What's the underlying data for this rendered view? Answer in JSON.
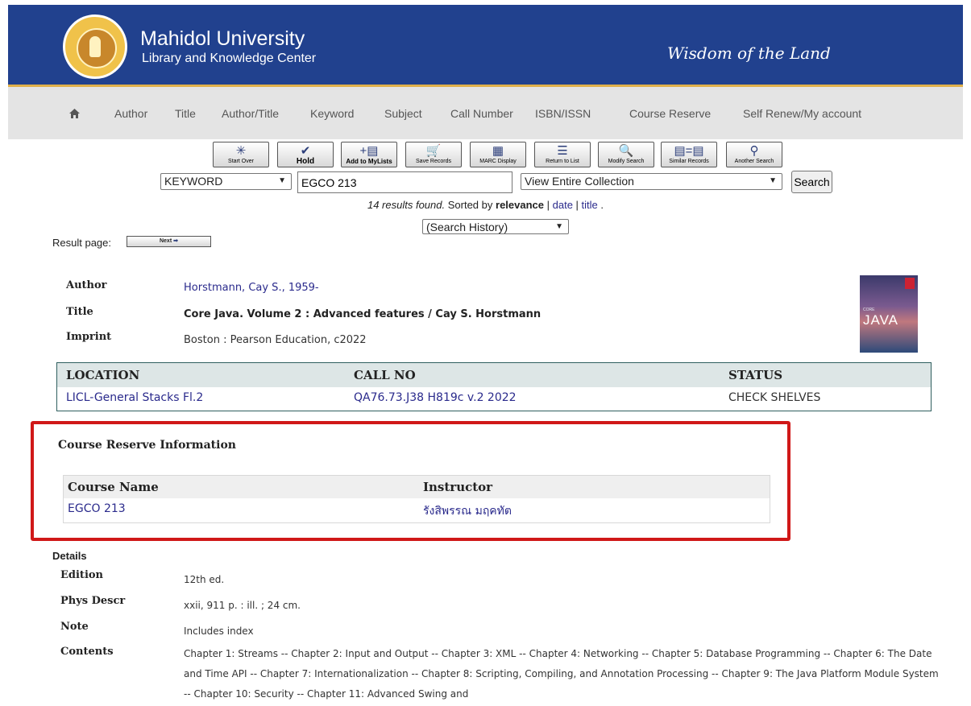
{
  "header": {
    "university": "Mahidol University",
    "subtitle": "Library and Knowledge Center",
    "motto": "Wisdom of the Land",
    "colors": {
      "banner": "#21418e",
      "accent": "#e0b04a"
    }
  },
  "nav": {
    "home_icon": "home-icon",
    "items": [
      "Author",
      "Title",
      "Author/Title",
      "Keyword",
      "Subject",
      "Call Number",
      "ISBN/ISSN",
      "Course Reserve",
      "Self Renew/My account"
    ]
  },
  "toolbar": {
    "buttons": [
      {
        "label": "Start Over",
        "icon": "asterisk-icon"
      },
      {
        "label": "Hold",
        "icon": "check-icon"
      },
      {
        "label": "Add to MyLists",
        "icon": "add-list-icon"
      },
      {
        "label": "Save Records",
        "icon": "cart-icon"
      },
      {
        "label": "MARC Display",
        "icon": "marc-icon"
      },
      {
        "label": "Return to List",
        "icon": "return-list-icon"
      },
      {
        "label": "Modify Search",
        "icon": "modify-search-icon"
      },
      {
        "label": "Similar Records",
        "icon": "similar-records-icon"
      },
      {
        "label": "Another Search",
        "icon": "magnifier-icon"
      }
    ]
  },
  "search": {
    "field": "KEYWORD",
    "query": "EGCO 213",
    "scope": "View Entire Collection",
    "button": "Search",
    "results_found": "14 results found.",
    "sorted_by": "Sorted by",
    "sort_current": "relevance",
    "sort_date": "date",
    "sort_title": "title",
    "history": "(Search History)"
  },
  "result_page": {
    "label": "Result page:",
    "next": "Next"
  },
  "record": {
    "author_label": "Author",
    "author": "Horstmann, Cay S., 1959-",
    "title_label": "Title",
    "title": "Core Java. Volume 2 : Advanced features / Cay S. Horstmann",
    "imprint_label": "Imprint",
    "imprint": "Boston : Pearson Education, c2022",
    "cover": {
      "small": "CORE",
      "big": "JAVA"
    }
  },
  "holdings": {
    "headers": [
      "LOCATION",
      "CALL NO",
      "STATUS"
    ],
    "rows": [
      [
        "LICL-General Stacks Fl.2",
        "QA76.73.J38 H819c v.2 2022",
        "CHECK SHELVES"
      ]
    ]
  },
  "course_reserve": {
    "title": "Course Reserve Information",
    "headers": [
      "Course Name",
      "Instructor"
    ],
    "rows": [
      [
        "EGCO 213",
        "รังสิพรรณ มฤคทัต"
      ]
    ],
    "highlight_color": "#d01818"
  },
  "details": {
    "label": "Details",
    "edition_label": "Edition",
    "edition": "12th ed.",
    "phys_label": "Phys Descr",
    "phys": "xxii, 911 p. : ill. ; 24 cm.",
    "note_label": "Note",
    "note": "Includes index",
    "contents_label": "Contents",
    "contents": "Chapter 1: Streams -- Chapter 2: Input and Output -- Chapter 3: XML -- Chapter 4: Networking -- Chapter 5: Database Programming -- Chapter 6: The Date and Time API -- Chapter 7: Internationalization -- Chapter 8: Scripting, Compiling, and Annotation Processing -- Chapter 9: The Java Platform Module System -- Chapter 10: Security -- Chapter 11: Advanced Swing and"
  }
}
